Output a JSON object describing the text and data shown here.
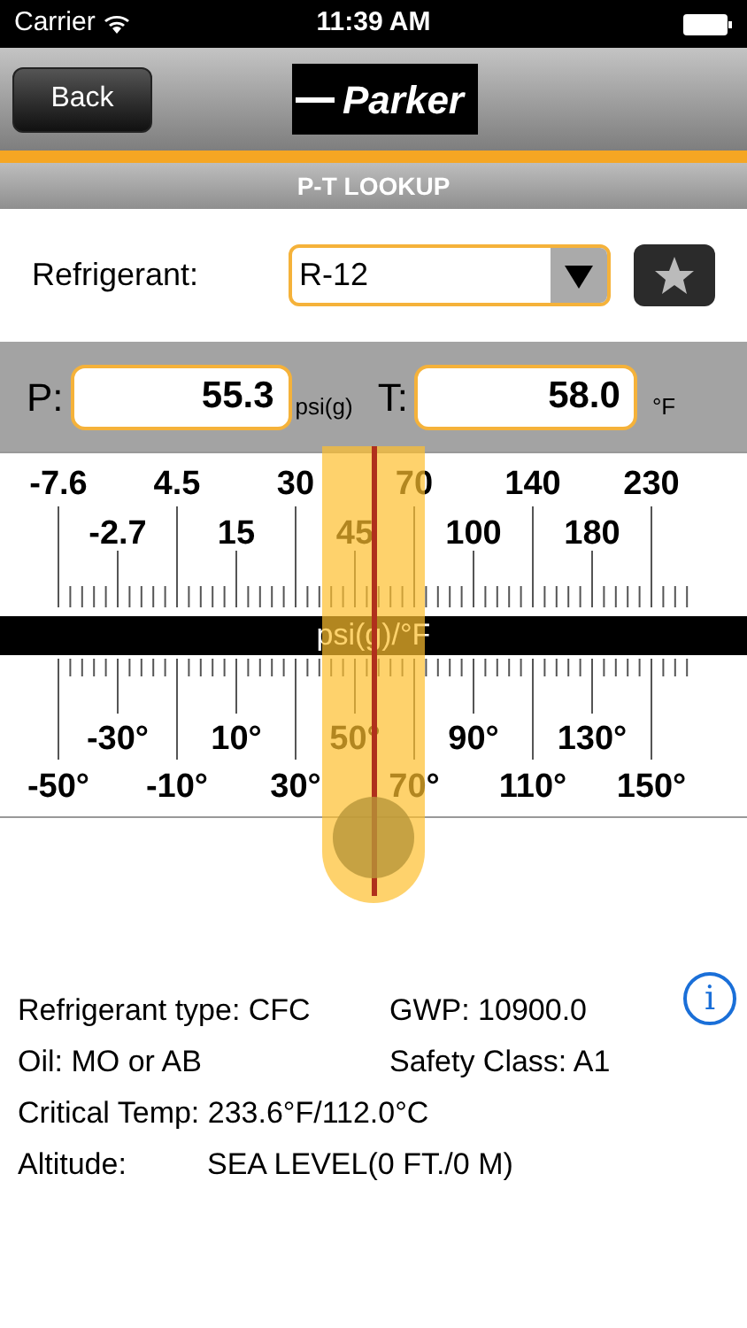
{
  "status_bar": {
    "carrier": "Carrier",
    "time": "11:39 AM"
  },
  "nav": {
    "back_button": "Back",
    "logo": "Parker"
  },
  "title": "P-T LOOKUP",
  "refrigerant": {
    "label": "Refrigerant:",
    "value": "R-12"
  },
  "pressure": {
    "label": "P:",
    "value": "55.3",
    "unit": "psi(g)"
  },
  "temperature": {
    "label": "T:",
    "value": "58.0",
    "unit": "°F"
  },
  "scale": {
    "pressure_row_1": [
      "-7.6",
      "4.5",
      "30",
      "70",
      "140",
      "230"
    ],
    "pressure_row_2": [
      "-2.7",
      "15",
      "45",
      "100",
      "180"
    ],
    "band_label": "psi(g)/°F",
    "temperature_row_1": [
      "-30°",
      "10°",
      "50°",
      "90°",
      "130°"
    ],
    "temperature_row_2": [
      "-50°",
      "-10°",
      "30°",
      "70°",
      "110°",
      "150°"
    ],
    "slider": {
      "level": 0.5
    }
  },
  "info": [
    {
      "label": "Refrigerant type: CFC",
      "value": "GWP: 10900.0"
    },
    {
      "label": "Oil: MO or AB",
      "value": "Safety Class: A1"
    },
    {
      "label": "Critical Temp: 233.6°F/112.0°C"
    },
    {
      "label": "Altitude:",
      "value": "SEA LEVEL(0 FT./0 M)"
    }
  ],
  "info_button": "i"
}
